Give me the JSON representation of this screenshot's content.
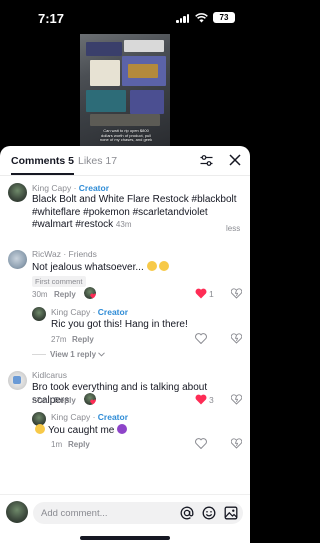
{
  "status_bar": {
    "time": "7:17",
    "battery": "73"
  },
  "video": {
    "caption": "Can wait to rip open $800 dollars worth of product, pull none of my chases, and geek"
  },
  "header": {
    "tab_comments": "Comments 5",
    "tab_likes": "Likes 17",
    "icons": [
      "filter-icon",
      "close-icon"
    ]
  },
  "comments": [
    {
      "username": "King Capy",
      "badge": "Creator",
      "text": "Black Bolt and White Flare Restock #blackbolt #whiteflare #pokemon #scarletandviolet #walmart #restock",
      "time": "43m",
      "toggle": "less"
    },
    {
      "username": "RicWaz",
      "badge": "Friends",
      "text": "Not jealous whatsoever...",
      "pill": "First comment",
      "time": "30m",
      "reply_label": "Reply",
      "likes": "1",
      "liked": true,
      "replies": [
        {
          "username": "King Capy",
          "badge": "Creator",
          "text": "Ric you got this! Hang in there!",
          "time": "27m",
          "reply_label": "Reply"
        }
      ],
      "view_replies": "View 1 reply"
    },
    {
      "username": "Kidlcarus",
      "text": "Bro took everything and is talking about scalpers",
      "time": "27m",
      "reply_label": "Reply",
      "likes": "3",
      "liked": true,
      "replies": [
        {
          "username": "King Capy",
          "badge": "Creator",
          "text": "You caught me",
          "time": "1m",
          "reply_label": "Reply"
        }
      ]
    }
  ],
  "input": {
    "placeholder": "Add comment...",
    "icons": [
      "at-icon",
      "emoji-icon",
      "image-icon"
    ]
  },
  "colors": {
    "accent_like": "#fe2c55",
    "creator_blue": "#2f8cd6",
    "muted": "#8a8b91"
  }
}
